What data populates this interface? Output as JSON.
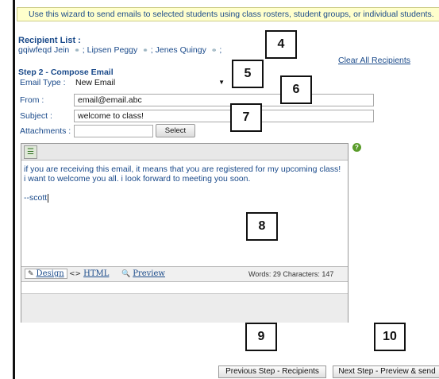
{
  "banner": "Use this wizard to send emails to selected students using class rosters, student groups, or individual students.",
  "recipients": {
    "title": "Recipient List :",
    "names": [
      "gqiwfeqd Jein",
      "Lipsen Peggy",
      "Jenes Quingy"
    ],
    "separator": ";",
    "clear_label": "Clear All Recipients"
  },
  "compose": {
    "title": "Step 2 - Compose Email",
    "email_type_label": "Email Type :",
    "email_type_value": "New Email",
    "from_label": "From :",
    "from_value": "email@email.abc",
    "subject_label": "Subject :",
    "subject_value": "welcome to class!",
    "attachments_label": "Attachments :",
    "select_button": "Select"
  },
  "editor": {
    "body_line1": "if you are receiving this email, it means that you are registered for my upcoming class!",
    "body_line2": "i want to welcome you all. i look forward to meeting you soon.",
    "signature": "--scott",
    "tab_design": "Design",
    "tab_html": "HTML",
    "tab_preview": "Preview",
    "word_count": "Words: 29  Characters: 147"
  },
  "annotations": [
    "4",
    "5",
    "6",
    "7",
    "8",
    "9",
    "10"
  ],
  "buttons": {
    "previous": "Previous Step - Recipients",
    "next": "Next Step - Preview & send"
  },
  "icons": {
    "recipient_remove": "paperclip-icon",
    "help": "help-icon",
    "toolbar": "toolbar-icon"
  },
  "colors": {
    "link": "#1a4a8a",
    "banner_bg": "#ffffcc",
    "help": "#5a9c2a"
  }
}
